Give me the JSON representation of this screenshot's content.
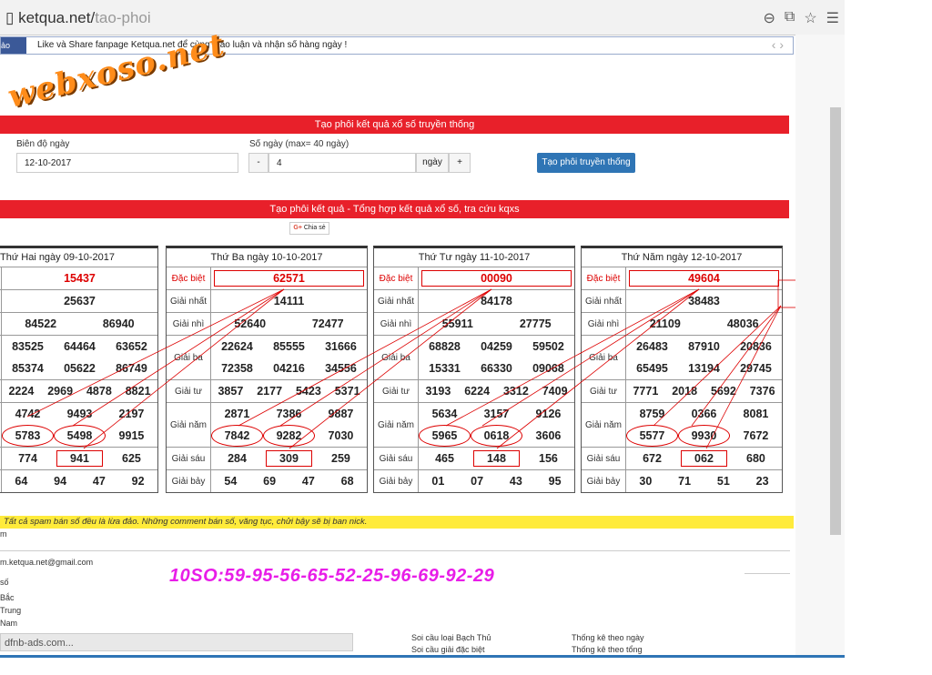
{
  "browser": {
    "url_host": "ketqua.net/",
    "url_path": "tao-phoi"
  },
  "fbbar": {
    "tag": "ảo",
    "text": "Like và Share fanpage Ketqua.net để cùng thảo luận và nhận số hàng ngày !"
  },
  "watermark": "webxoso.net",
  "form": {
    "title": "Tạo phôi kết quả xổ số truyền thống",
    "date_label": "Biên độ ngày",
    "date_value": "12-10-2017",
    "days_label": "Số ngày (max= 40 ngày)",
    "minus": "-",
    "days_value": "4",
    "days_unit": "ngày",
    "plus": "+",
    "submit": "Tạo phôi truyền thống"
  },
  "results_title": "Tạo phôi kết quả - Tổng hợp kết quả xổ số, tra cứu kqxs",
  "share": {
    "g": "G+",
    "label": "Chia sẻ"
  },
  "labels": {
    "db": "Đặc biệt",
    "g1": "Giải nhất",
    "g2": "Giải nhì",
    "g3": "Giải ba",
    "g4": "Giải tư",
    "g5": "Giải năm",
    "g6": "Giải sáu",
    "g7": "Giải bảy"
  },
  "cards": [
    {
      "header": "Thứ Hai ngày 09-10-2017",
      "db": "15437",
      "g1": "25637",
      "g2": [
        "84522",
        "86940"
      ],
      "g3": [
        "83525",
        "64464",
        "63652",
        "85374",
        "05622",
        "86749"
      ],
      "g4": [
        "2224",
        "2969",
        "4878",
        "8821"
      ],
      "g5": [
        "4742",
        "9493",
        "2197",
        "5783",
        "5498",
        "9915"
      ],
      "g6": [
        "774",
        "941",
        "625"
      ],
      "g7": [
        "64",
        "94",
        "47",
        "92"
      ]
    },
    {
      "header": "Thứ Ba ngày 10-10-2017",
      "db": "62571",
      "g1": "14111",
      "g2": [
        "52640",
        "72477"
      ],
      "g3": [
        "22624",
        "85555",
        "31666",
        "72358",
        "04216",
        "34556"
      ],
      "g4": [
        "3857",
        "2177",
        "5423",
        "5371"
      ],
      "g5": [
        "2871",
        "7386",
        "9887",
        "7842",
        "9282",
        "7030"
      ],
      "g6": [
        "284",
        "309",
        "259"
      ],
      "g7": [
        "54",
        "69",
        "47",
        "68"
      ]
    },
    {
      "header": "Thứ Tư ngày 11-10-2017",
      "db": "00090",
      "g1": "84178",
      "g2": [
        "55911",
        "27775"
      ],
      "g3": [
        "68828",
        "04259",
        "59502",
        "15331",
        "66330",
        "09068"
      ],
      "g4": [
        "3193",
        "6224",
        "3312",
        "7409"
      ],
      "g5": [
        "5634",
        "3157",
        "9126",
        "5965",
        "0618",
        "3606"
      ],
      "g6": [
        "465",
        "148",
        "156"
      ],
      "g7": [
        "01",
        "07",
        "43",
        "95"
      ]
    },
    {
      "header": "Thứ Năm ngày 12-10-2017",
      "db": "49604",
      "g1": "38483",
      "g2": [
        "21109",
        "48036"
      ],
      "g3": [
        "26483",
        "87910",
        "20836",
        "65495",
        "13194",
        "29745"
      ],
      "g4": [
        "7771",
        "2018",
        "5692",
        "7376"
      ],
      "g5": [
        "8759",
        "0366",
        "8081",
        "5577",
        "9930",
        "7672"
      ],
      "g6": [
        "672",
        "062",
        "680"
      ],
      "g7": [
        "30",
        "71",
        "51",
        "23"
      ]
    }
  ],
  "notice": "Tất cả spam bán số đều là lừa đảo. Những comment bán số, văng tục, chửi bậy sẽ bị ban nick.",
  "footer": {
    "m_text": "m",
    "email": "m.ketqua.net@gmail.com",
    "big_numbers": "10SO:59-95-56-65-52-25-96-69-92-29",
    "links_left": [
      "số",
      "Bắc",
      "Trung",
      "Nam"
    ],
    "links_mid": [
      "Soi cầu loại Bạch Thủ",
      "Soi cầu giải đặc biệt"
    ],
    "links_right": [
      "Thống kê theo ngày",
      "Thống kê theo tổng"
    ],
    "status": "dfnb-ads.com..."
  }
}
